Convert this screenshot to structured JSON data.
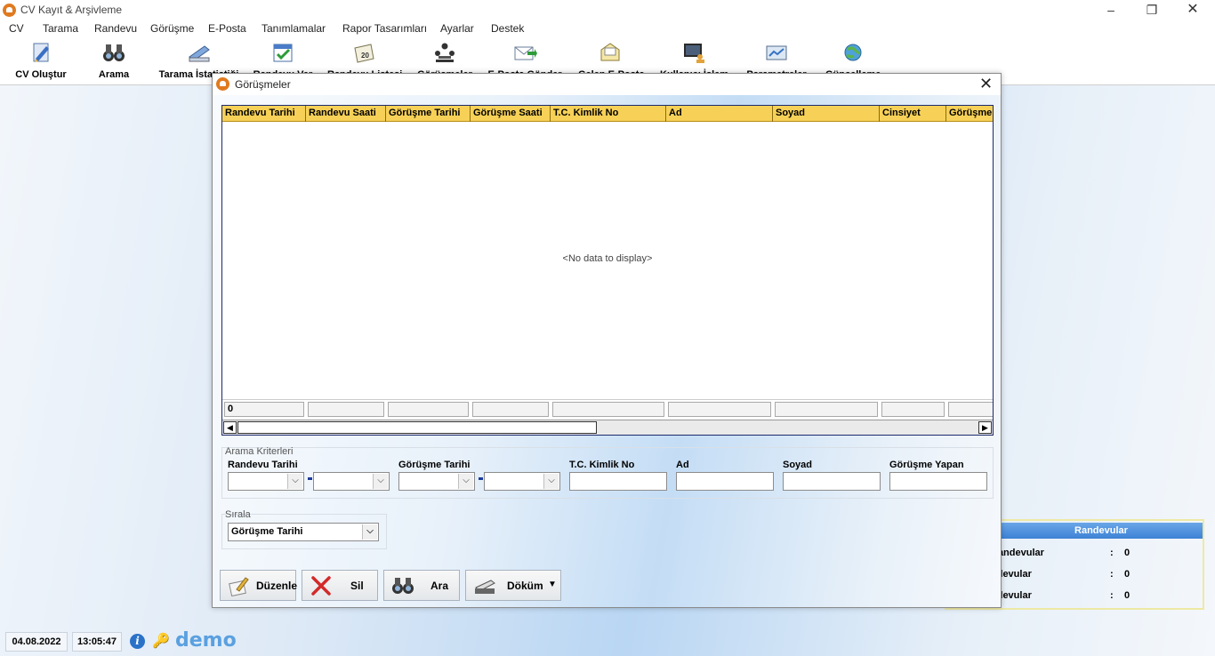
{
  "window": {
    "title": "CV Kayıt & Arşivleme",
    "controls": [
      "–",
      "❐",
      "✕"
    ]
  },
  "menu": [
    "CV",
    "Tarama",
    "Randevu",
    "Görüşme",
    "E-Posta",
    "Tanımlamalar",
    "Rapor Tasarımları",
    "Ayarlar",
    "Destek"
  ],
  "toolbar": [
    {
      "label": "CV Oluştur",
      "icon": "document-pen-icon"
    },
    {
      "label": "Arama",
      "icon": "binoculars-icon"
    },
    {
      "label": "Tarama İstatistiği",
      "icon": "scanner-icon"
    },
    {
      "label": "Randevu Ver",
      "icon": "calendar-check-icon"
    },
    {
      "label": "Randevu Listesi",
      "icon": "calendar-icon"
    },
    {
      "label": "Görüşmeler",
      "icon": "meeting-icon"
    },
    {
      "label": "E-Posta Gönder",
      "icon": "email-send-icon"
    },
    {
      "label": "Gelen E-Posta",
      "icon": "email-inbox-icon"
    },
    {
      "label": "Kullanıcı İşlem",
      "icon": "users-icon"
    },
    {
      "label": "Parametreler",
      "icon": "settings-panel-icon"
    },
    {
      "label": "Güncelleme",
      "icon": "globe-update-icon"
    }
  ],
  "dialog": {
    "title": "Görüşmeler",
    "close": "✕",
    "grid": {
      "columns": [
        "Randevu Tarihi",
        "Randevu Saati",
        "Görüşme Tarihi",
        "Görüşme Saati",
        "T.C. Kimlik No",
        "Ad",
        "Soyad",
        "Cinsiyet",
        "Görüşme Yapan"
      ],
      "empty_text": "<No data to display>",
      "footer_count": "0"
    },
    "criteria": {
      "title": "Arama Kriterleri",
      "randevu_tarihi": "Randevu Tarihi",
      "gorusme_tarihi": "Görüşme Tarihi",
      "tc": "T.C. Kimlik No",
      "ad": "Ad",
      "soyad": "Soyad",
      "gorusme_yapan": "Görüşme Yapan"
    },
    "sort": {
      "title": "Sırala",
      "value": "Görüşme Tarihi"
    },
    "buttons": {
      "edit": "Düzenle",
      "delete": "Sil",
      "search": "Ara",
      "print": "Döküm"
    }
  },
  "randevular": {
    "title": "Randevular",
    "rows": [
      {
        "label": "Randevular",
        "value": "0"
      },
      {
        "label": "ndevular",
        "value": "0"
      },
      {
        "label": "ndevular",
        "value": "0"
      }
    ]
  },
  "status": {
    "date": "04.08.2022",
    "time": "13:05:47",
    "logo": "demo"
  }
}
